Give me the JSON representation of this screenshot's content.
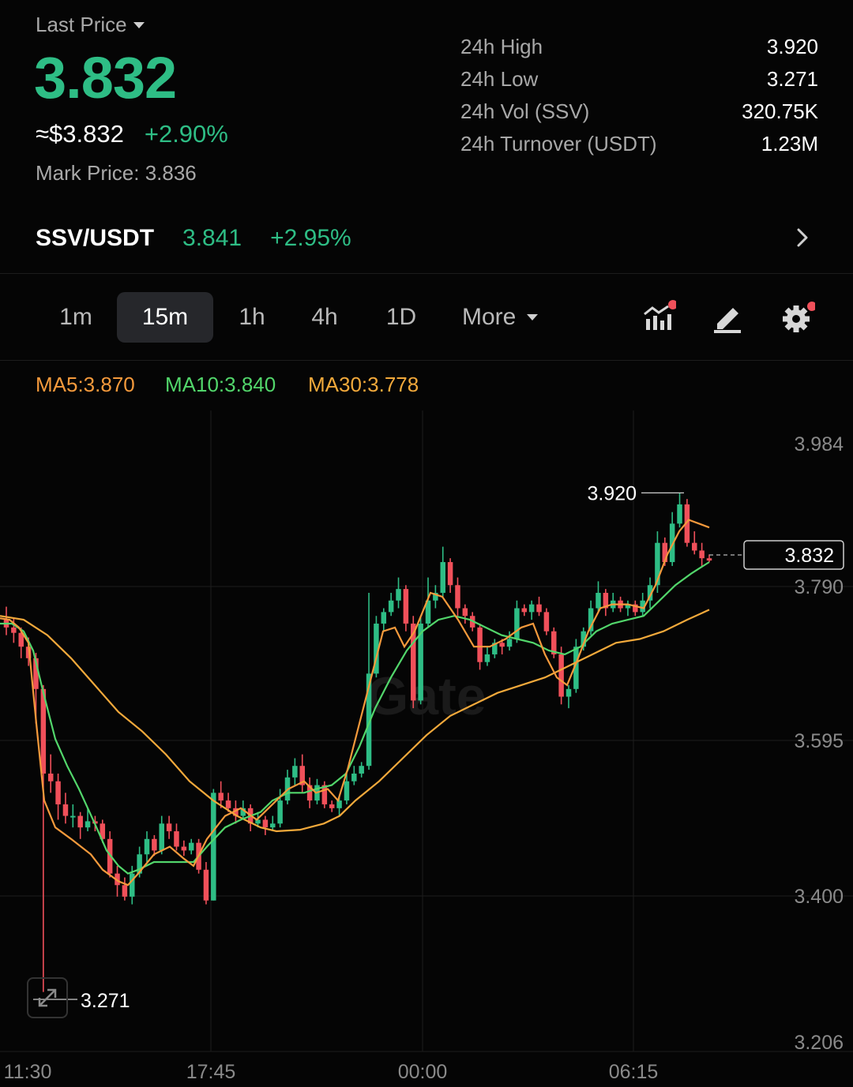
{
  "header": {
    "last_price_label": "Last Price",
    "last_price": "3.832",
    "usd_price": "≈$3.832",
    "change_pct": "+2.90%",
    "mark_price_label": "Mark Price:",
    "mark_price": "3.836"
  },
  "stats": [
    {
      "label": "24h High",
      "value": "3.920"
    },
    {
      "label": "24h Low",
      "value": "3.271"
    },
    {
      "label": "24h Vol (SSV)",
      "value": "320.75K"
    },
    {
      "label": "24h Turnover (USDT)",
      "value": "1.23M"
    }
  ],
  "pair": {
    "name": "SSV/USDT",
    "price": "3.841",
    "change": "+2.95%"
  },
  "timeframes": [
    "1m",
    "15m",
    "1h",
    "4h",
    "1D"
  ],
  "active_timeframe": "15m",
  "more_label": "More",
  "toolbar_icons": [
    "indicators-icon",
    "draw-icon",
    "settings-icon"
  ],
  "ma": {
    "ma5": "MA5:3.870",
    "ma10": "MA10:3.840",
    "ma30": "MA30:3.778"
  },
  "colors": {
    "up": "#2ebd85",
    "down": "#f0505a",
    "ma5": "#f59a3c",
    "ma10": "#52d66b",
    "ma30": "#f2a93b"
  },
  "chart_data": {
    "type": "candlestick",
    "watermark": "Gate",
    "y_ticks": [
      "3.984",
      "3.790",
      "3.595",
      "3.400",
      "3.206"
    ],
    "ylim": [
      3.206,
      3.984
    ],
    "x_ticks": [
      "11:30",
      "17:45",
      "00:00",
      "06:15"
    ],
    "high_marker": "3.920",
    "low_marker": "3.271",
    "current_price_tag": "3.832",
    "candles": [
      [
        3.755,
        3.745,
        3.772,
        3.735
      ],
      [
        3.745,
        3.738,
        3.758,
        3.725
      ],
      [
        3.738,
        3.72,
        3.745,
        3.705
      ],
      [
        3.72,
        3.705,
        3.732,
        3.695
      ],
      [
        3.705,
        3.665,
        3.712,
        3.62
      ],
      [
        3.665,
        3.555,
        3.67,
        3.271
      ],
      [
        3.555,
        3.545,
        3.58,
        3.53
      ],
      [
        3.545,
        3.515,
        3.555,
        3.495
      ],
      [
        3.515,
        3.5,
        3.53,
        3.49
      ],
      [
        3.5,
        3.5,
        3.515,
        3.485
      ],
      [
        3.5,
        3.485,
        3.505,
        3.47
      ],
      [
        3.485,
        3.493,
        3.51,
        3.48
      ],
      [
        3.493,
        3.49,
        3.5,
        3.48
      ],
      [
        3.49,
        3.47,
        3.495,
        3.465
      ],
      [
        3.47,
        3.425,
        3.48,
        3.42
      ],
      [
        3.425,
        3.41,
        3.435,
        3.395
      ],
      [
        3.41,
        3.395,
        3.42,
        3.39
      ],
      [
        3.395,
        3.425,
        3.435,
        3.385
      ],
      [
        3.425,
        3.45,
        3.46,
        3.42
      ],
      [
        3.45,
        3.47,
        3.48,
        3.44
      ],
      [
        3.47,
        3.455,
        3.475,
        3.448
      ],
      [
        3.455,
        3.49,
        3.5,
        3.45
      ],
      [
        3.49,
        3.48,
        3.5,
        3.47
      ],
      [
        3.48,
        3.46,
        3.49,
        3.455
      ],
      [
        3.46,
        3.455,
        3.468,
        3.448
      ],
      [
        3.455,
        3.465,
        3.47,
        3.45
      ],
      [
        3.465,
        3.43,
        3.47,
        3.425
      ],
      [
        3.43,
        3.39,
        3.44,
        3.385
      ],
      [
        3.39,
        3.53,
        3.535,
        3.39
      ],
      [
        3.53,
        3.52,
        3.545,
        3.51
      ],
      [
        3.52,
        3.51,
        3.53,
        3.505
      ],
      [
        3.51,
        3.5,
        3.52,
        3.49
      ],
      [
        3.5,
        3.51,
        3.52,
        3.495
      ],
      [
        3.51,
        3.49,
        3.515,
        3.48
      ],
      [
        3.49,
        3.495,
        3.505,
        3.485
      ],
      [
        3.495,
        3.485,
        3.5,
        3.475
      ],
      [
        3.485,
        3.49,
        3.5,
        3.48
      ],
      [
        3.49,
        3.52,
        3.535,
        3.485
      ],
      [
        3.52,
        3.55,
        3.56,
        3.515
      ],
      [
        3.55,
        3.565,
        3.575,
        3.54
      ],
      [
        3.565,
        3.54,
        3.58,
        3.53
      ],
      [
        3.54,
        3.52,
        3.55,
        3.51
      ],
      [
        3.52,
        3.54,
        3.548,
        3.515
      ],
      [
        3.54,
        3.515,
        3.545,
        3.51
      ],
      [
        3.515,
        3.51,
        3.52,
        3.505
      ],
      [
        3.51,
        3.52,
        3.525,
        3.5
      ],
      [
        3.52,
        3.545,
        3.555,
        3.515
      ],
      [
        3.545,
        3.555,
        3.565,
        3.54
      ],
      [
        3.555,
        3.565,
        3.57,
        3.55
      ],
      [
        3.565,
        3.685,
        3.79,
        3.56
      ],
      [
        3.685,
        3.75,
        3.76,
        3.68
      ],
      [
        3.75,
        3.765,
        3.77,
        3.74
      ],
      [
        3.765,
        3.78,
        3.79,
        3.76
      ],
      [
        3.78,
        3.795,
        3.81,
        3.77
      ],
      [
        3.795,
        3.75,
        3.8,
        3.74
      ],
      [
        3.75,
        3.65,
        3.76,
        3.64
      ],
      [
        3.65,
        3.75,
        3.76,
        3.645
      ],
      [
        3.75,
        3.78,
        3.81,
        3.745
      ],
      [
        3.78,
        3.79,
        3.8,
        3.77
      ],
      [
        3.79,
        3.83,
        3.85,
        3.785
      ],
      [
        3.83,
        3.8,
        3.835,
        3.79
      ],
      [
        3.8,
        3.77,
        3.81,
        3.76
      ],
      [
        3.77,
        3.76,
        3.775,
        3.75
      ],
      [
        3.76,
        3.745,
        3.765,
        3.74
      ],
      [
        3.745,
        3.7,
        3.75,
        3.69
      ],
      [
        3.7,
        3.71,
        3.72,
        3.695
      ],
      [
        3.71,
        3.725,
        3.73,
        3.705
      ],
      [
        3.725,
        3.72,
        3.73,
        3.71
      ],
      [
        3.72,
        3.73,
        3.74,
        3.715
      ],
      [
        3.73,
        3.77,
        3.78,
        3.725
      ],
      [
        3.77,
        3.765,
        3.775,
        3.76
      ],
      [
        3.765,
        3.775,
        3.78,
        3.755
      ],
      [
        3.775,
        3.765,
        3.785,
        3.76
      ],
      [
        3.765,
        3.74,
        3.77,
        3.735
      ],
      [
        3.74,
        3.71,
        3.745,
        3.705
      ],
      [
        3.71,
        3.655,
        3.72,
        3.645
      ],
      [
        3.655,
        3.665,
        3.67,
        3.64
      ],
      [
        3.665,
        3.72,
        3.73,
        3.66
      ],
      [
        3.72,
        3.74,
        3.745,
        3.715
      ],
      [
        3.74,
        3.77,
        3.78,
        3.735
      ],
      [
        3.77,
        3.79,
        3.805,
        3.765
      ],
      [
        3.79,
        3.77,
        3.795,
        3.76
      ],
      [
        3.77,
        3.78,
        3.79,
        3.765
      ],
      [
        3.78,
        3.77,
        3.785,
        3.765
      ],
      [
        3.77,
        3.775,
        3.78,
        3.76
      ],
      [
        3.775,
        3.765,
        3.78,
        3.76
      ],
      [
        3.765,
        3.78,
        3.79,
        3.76
      ],
      [
        3.78,
        3.8,
        3.81,
        3.77
      ],
      [
        3.8,
        3.855,
        3.87,
        3.79
      ],
      [
        3.855,
        3.83,
        3.862,
        3.825
      ],
      [
        3.83,
        3.88,
        3.895,
        3.825
      ],
      [
        3.88,
        3.905,
        3.92,
        3.875
      ],
      [
        3.905,
        3.855,
        3.912,
        3.85
      ],
      [
        3.855,
        3.845,
        3.87,
        3.84
      ],
      [
        3.845,
        3.835,
        3.855,
        3.825
      ],
      [
        3.835,
        3.832,
        3.84,
        3.83
      ]
    ],
    "ma5_line": [
      [
        0,
        3.757
      ],
      [
        12,
        3.755
      ],
      [
        24,
        3.745
      ],
      [
        36,
        3.725
      ],
      [
        46,
        3.62
      ],
      [
        56,
        3.52
      ],
      [
        70,
        3.485
      ],
      [
        90,
        3.47
      ],
      [
        115,
        3.45
      ],
      [
        130,
        3.43
      ],
      [
        150,
        3.415
      ],
      [
        162,
        3.41
      ],
      [
        175,
        3.425
      ],
      [
        195,
        3.45
      ],
      [
        215,
        3.46
      ],
      [
        232,
        3.445
      ],
      [
        245,
        3.435
      ],
      [
        262,
        3.47
      ],
      [
        285,
        3.5
      ],
      [
        305,
        3.51
      ],
      [
        325,
        3.495
      ],
      [
        345,
        3.515
      ],
      [
        365,
        3.535
      ],
      [
        385,
        3.545
      ],
      [
        400,
        3.53
      ],
      [
        415,
        3.535
      ],
      [
        428,
        3.52
      ],
      [
        440,
        3.56
      ],
      [
        455,
        3.62
      ],
      [
        470,
        3.68
      ],
      [
        485,
        3.74
      ],
      [
        500,
        3.745
      ],
      [
        512,
        3.72
      ],
      [
        525,
        3.74
      ],
      [
        545,
        3.79
      ],
      [
        560,
        3.785
      ],
      [
        580,
        3.755
      ],
      [
        600,
        3.72
      ],
      [
        620,
        3.72
      ],
      [
        640,
        3.73
      ],
      [
        660,
        3.745
      ],
      [
        675,
        3.75
      ],
      [
        690,
        3.71
      ],
      [
        705,
        3.68
      ],
      [
        718,
        3.67
      ],
      [
        730,
        3.7
      ],
      [
        745,
        3.74
      ],
      [
        760,
        3.77
      ],
      [
        775,
        3.775
      ],
      [
        795,
        3.775
      ],
      [
        815,
        3.77
      ],
      [
        830,
        3.8
      ],
      [
        845,
        3.84
      ],
      [
        860,
        3.87
      ],
      [
        872,
        3.885
      ],
      [
        885,
        3.88
      ],
      [
        898,
        3.875
      ]
    ],
    "ma10_line": [
      [
        0,
        3.75
      ],
      [
        15,
        3.75
      ],
      [
        30,
        3.74
      ],
      [
        42,
        3.715
      ],
      [
        55,
        3.66
      ],
      [
        70,
        3.6
      ],
      [
        85,
        3.565
      ],
      [
        100,
        3.535
      ],
      [
        120,
        3.49
      ],
      [
        135,
        3.455
      ],
      [
        150,
        3.435
      ],
      [
        162,
        3.425
      ],
      [
        175,
        3.43
      ],
      [
        195,
        3.44
      ],
      [
        215,
        3.44
      ],
      [
        232,
        3.44
      ],
      [
        245,
        3.44
      ],
      [
        262,
        3.46
      ],
      [
        285,
        3.485
      ],
      [
        305,
        3.495
      ],
      [
        330,
        3.505
      ],
      [
        345,
        3.52
      ],
      [
        365,
        3.53
      ],
      [
        385,
        3.53
      ],
      [
        400,
        3.535
      ],
      [
        420,
        3.54
      ],
      [
        438,
        3.555
      ],
      [
        455,
        3.59
      ],
      [
        475,
        3.64
      ],
      [
        495,
        3.68
      ],
      [
        515,
        3.715
      ],
      [
        535,
        3.74
      ],
      [
        555,
        3.755
      ],
      [
        575,
        3.76
      ],
      [
        595,
        3.755
      ],
      [
        615,
        3.745
      ],
      [
        635,
        3.735
      ],
      [
        655,
        3.73
      ],
      [
        675,
        3.725
      ],
      [
        695,
        3.715
      ],
      [
        715,
        3.71
      ],
      [
        735,
        3.72
      ],
      [
        755,
        3.74
      ],
      [
        775,
        3.75
      ],
      [
        795,
        3.755
      ],
      [
        815,
        3.76
      ],
      [
        835,
        3.78
      ],
      [
        855,
        3.8
      ],
      [
        875,
        3.815
      ],
      [
        898,
        3.83
      ]
    ],
    "ma30_line": [
      [
        0,
        3.76
      ],
      [
        30,
        3.755
      ],
      [
        60,
        3.735
      ],
      [
        90,
        3.705
      ],
      [
        120,
        3.67
      ],
      [
        150,
        3.635
      ],
      [
        180,
        3.61
      ],
      [
        210,
        3.58
      ],
      [
        240,
        3.545
      ],
      [
        270,
        3.52
      ],
      [
        300,
        3.5
      ],
      [
        330,
        3.485
      ],
      [
        350,
        3.48
      ],
      [
        380,
        3.482
      ],
      [
        410,
        3.49
      ],
      [
        430,
        3.5
      ],
      [
        450,
        3.52
      ],
      [
        480,
        3.545
      ],
      [
        510,
        3.575
      ],
      [
        540,
        3.605
      ],
      [
        570,
        3.63
      ],
      [
        600,
        3.645
      ],
      [
        630,
        3.66
      ],
      [
        660,
        3.67
      ],
      [
        690,
        3.68
      ],
      [
        720,
        3.695
      ],
      [
        750,
        3.71
      ],
      [
        780,
        3.725
      ],
      [
        810,
        3.73
      ],
      [
        840,
        3.74
      ],
      [
        870,
        3.755
      ],
      [
        898,
        3.768
      ]
    ]
  }
}
